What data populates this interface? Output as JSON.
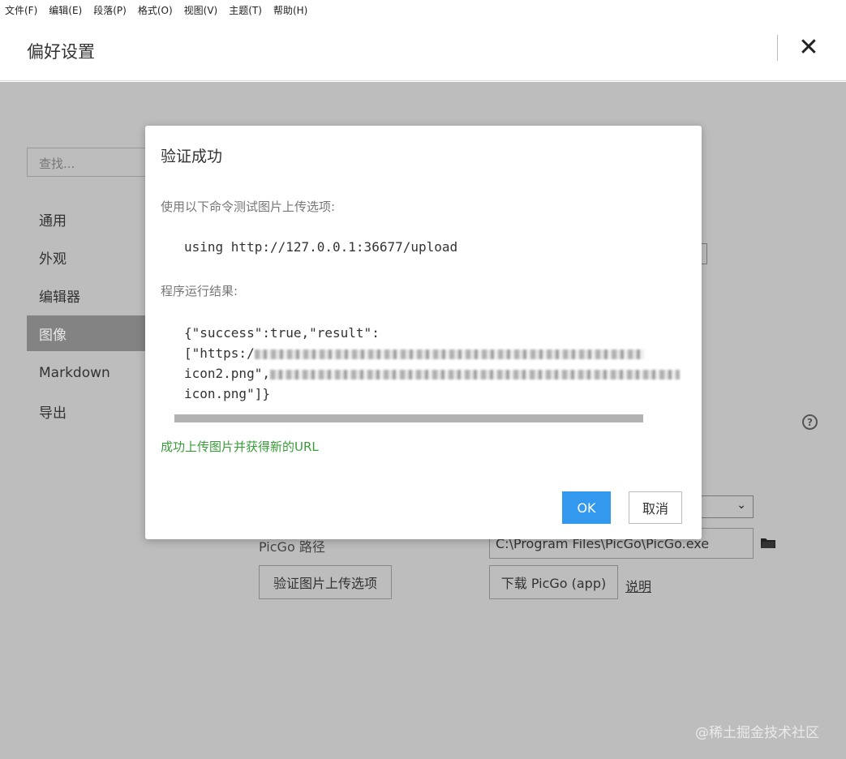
{
  "menubar": {
    "items": [
      "文件(F)",
      "编辑(E)",
      "段落(P)",
      "格式(O)",
      "视图(V)",
      "主题(T)",
      "帮助(H)"
    ]
  },
  "preferences": {
    "title": "偏好设置",
    "close_icon": "close-icon",
    "search_placeholder": "查找...",
    "nav": [
      {
        "label": "通用",
        "active": false
      },
      {
        "label": "外观",
        "active": false
      },
      {
        "label": "编辑器",
        "active": false
      },
      {
        "label": "图像",
        "active": true
      },
      {
        "label": "Markdown",
        "active": false
      },
      {
        "label": "导出",
        "active": false
      }
    ],
    "picgo_path_label": "PicGo 路径",
    "picgo_path_value": "C:\\Program Files\\PicGo\\PicGo.exe",
    "verify_button": "验证图片上传选项",
    "download_button": "下载 PicGo (app)",
    "explain_link": "说明",
    "help_icon": "question-circle-icon",
    "folder_icon": "folder-icon"
  },
  "dialog": {
    "title": "验证成功",
    "command_label": "使用以下命令测试图片上传选项:",
    "command": "using http://127.0.0.1:36677/upload",
    "result_label": "程序运行结果:",
    "result_line1": "{\"success\":true,\"result\":",
    "result_line2_prefix": "[\"https:/",
    "result_line3_prefix": "icon2.png\",",
    "result_line4": "icon.png\"]}",
    "success_message": "成功上传图片并获得新的URL",
    "ok_label": "OK",
    "cancel_label": "取消"
  },
  "watermark": "@稀土掘金技术社区",
  "colors": {
    "accent": "#3399ee",
    "success": "#3a9b3a",
    "overlay": "#bdbdbd",
    "active_nav": "#838383"
  }
}
